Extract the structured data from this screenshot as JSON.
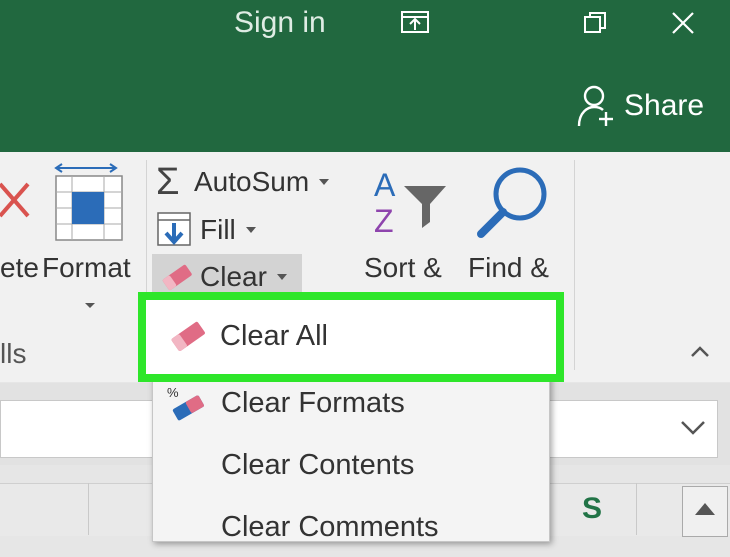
{
  "titlebar": {
    "signin_label": "Sign in",
    "share_label": "Share",
    "icons": [
      "ribbon-display-options-icon",
      "restore-icon",
      "close-icon",
      "share-person-icon"
    ]
  },
  "ribbon": {
    "delete_label_partial": "ete",
    "format_label": "Format",
    "cells_group_partial": "lls",
    "autosum_label": "AutoSum",
    "fill_label": "Fill",
    "clear_label": "Clear",
    "sort_label": "Sort &",
    "find_label": "Find &"
  },
  "clear_menu": {
    "items": [
      {
        "label": "Clear All",
        "icon": "eraser-icon"
      },
      {
        "label": "Clear Formats",
        "icon": "clear-formats-icon"
      },
      {
        "label": "Clear Contents",
        "icon": ""
      },
      {
        "label": "Clear Comments",
        "icon": ""
      }
    ]
  },
  "sheet": {
    "column_s": "S"
  },
  "colors": {
    "titlebar_green": "#21683f",
    "highlight_green": "#2ee62a",
    "eraser_pink": "#e06c85",
    "blue_accent": "#2b6cb8"
  }
}
